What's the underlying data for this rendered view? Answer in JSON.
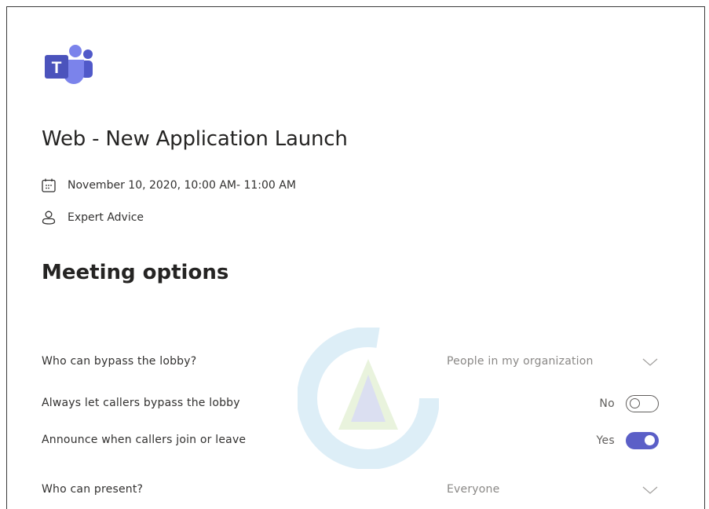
{
  "meeting": {
    "title": "Web - New Application Launch",
    "datetime": "November 10, 2020, 10:00 AM- 11:00 AM",
    "organizer": "Expert Advice"
  },
  "section": {
    "title": "Meeting options"
  },
  "options": {
    "lobby_bypass": {
      "label": "Who can bypass the lobby?",
      "value": "People in my organization"
    },
    "callers_bypass": {
      "label": "Always let callers bypass the lobby",
      "state_label": "No",
      "enabled": false
    },
    "announce": {
      "label": "Announce when callers join or leave",
      "state_label": "Yes",
      "enabled": true
    },
    "presenters": {
      "label": "Who can present?",
      "value": "Everyone"
    }
  },
  "colors": {
    "accent": "#5b5fc7",
    "text": "#252423",
    "muted": "#8a8886"
  },
  "icons": {
    "logo": "teams-logo-icon",
    "date": "calendar-icon",
    "organizer": "person-icon",
    "dropdown": "chevron-down-icon"
  }
}
